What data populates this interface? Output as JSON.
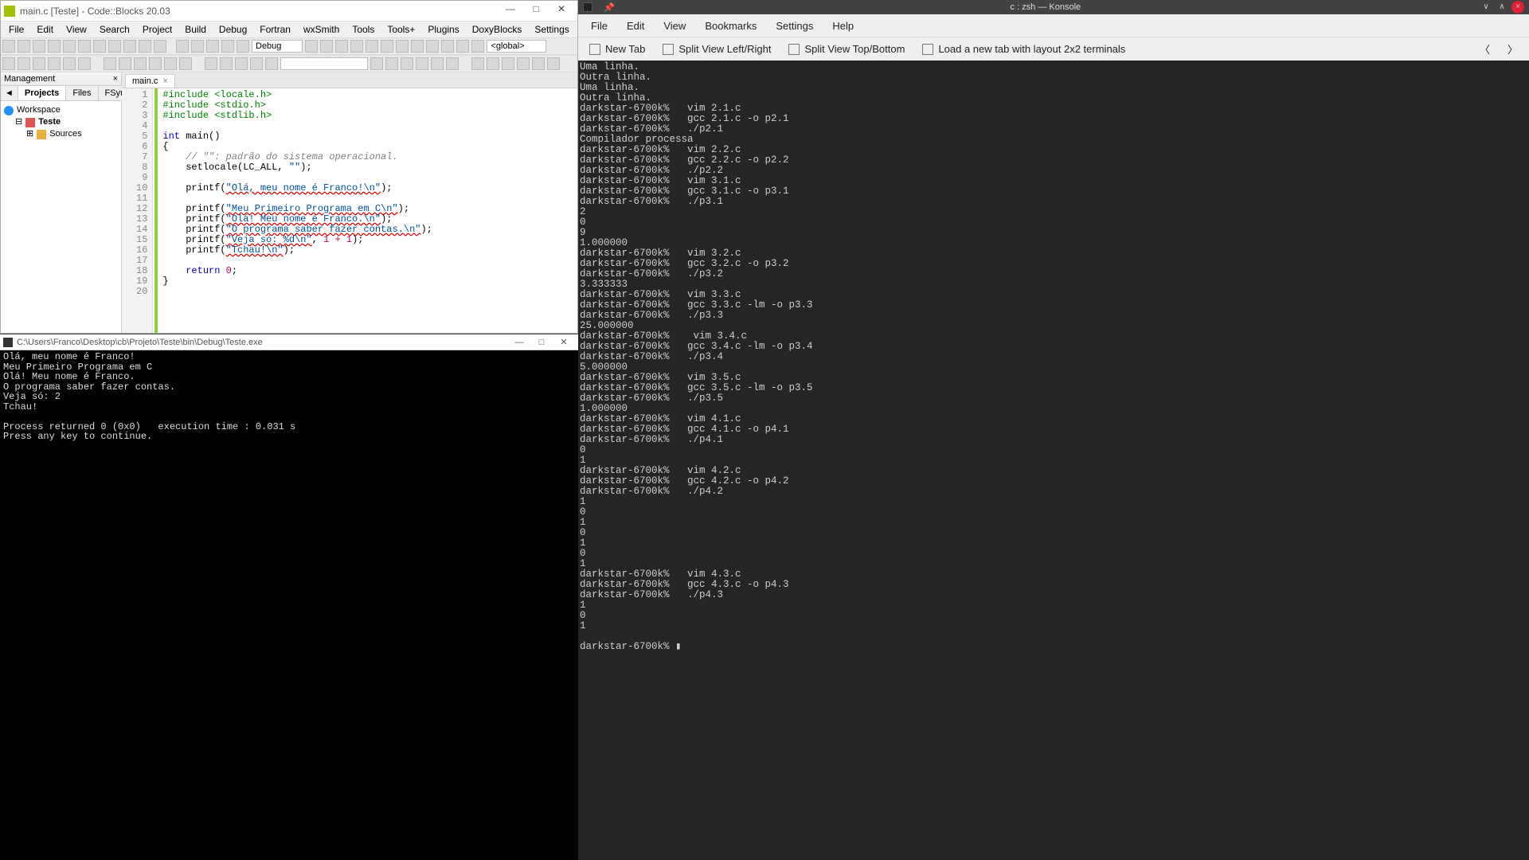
{
  "codeblocks": {
    "title": "main.c [Teste] - Code::Blocks 20.03",
    "menu": [
      "File",
      "Edit",
      "View",
      "Search",
      "Project",
      "Build",
      "Debug",
      "Fortran",
      "wxSmith",
      "Tools",
      "Tools+",
      "Plugins",
      "DoxyBlocks",
      "Settings",
      "Help"
    ],
    "buildTarget": "Debug",
    "scope": "<global>",
    "mgmt": {
      "title": "Management",
      "tabs": [
        "Projects",
        "Files",
        "FSymbols"
      ],
      "workspace": "Workspace",
      "project": "Teste",
      "sources": "Sources"
    },
    "editorTab": "main.c",
    "code": {
      "1": {
        "pre": "#include <locale.h>"
      },
      "2": {
        "pre": "#include <stdio.h>"
      },
      "3": {
        "pre": "#include <stdlib.h>"
      },
      "4": {
        "plain": ""
      },
      "5": {
        "kw": "int",
        "plain": " main()"
      },
      "6": {
        "plain": "{"
      },
      "7": {
        "cm": "    // \"\": padrão do sistema operacional."
      },
      "8": {
        "plain": "    setlocale(LC_ALL, ",
        "str": "\"\"",
        "plain2": ");"
      },
      "9": {
        "plain": ""
      },
      "10": {
        "plain": "    printf(",
        "str": "\"Olá, meu nome é Franco!\\n\"",
        "plain2": ");"
      },
      "11": {
        "plain": ""
      },
      "12": {
        "plain": "    printf(",
        "str": "\"Meu Primeiro Programa em C\\n\"",
        "plain2": ");"
      },
      "13": {
        "plain": "    printf(",
        "str": "\"Olá! Meu nome é Franco.\\n\"",
        "plain2": ");"
      },
      "14": {
        "plain": "    printf(",
        "str": "\"O programa saber fazer contas.\\n\"",
        "plain2": ");"
      },
      "15": {
        "plain": "    printf(",
        "str": "\"Veja só: %d\\n\"",
        "plain2": ", ",
        "num": "1 + 1",
        "plain3": ");"
      },
      "16": {
        "plain": "    printf(",
        "str": "\"Tchau!\\n\"",
        "plain2": ");"
      },
      "17": {
        "plain": ""
      },
      "18": {
        "plain": "    ",
        "kw": "return",
        "plain2": " ",
        "num": "0",
        "plain3": ";"
      },
      "19": {
        "plain": "}"
      },
      "20": {
        "plain": ""
      }
    }
  },
  "console": {
    "title": "C:\\Users\\Franco\\Desktop\\cb\\Projeto\\Teste\\bin\\Debug\\Teste.exe",
    "lines": [
      "Olá, meu nome é Franco!",
      "Meu Primeiro Programa em C",
      "Olá! Meu nome é Franco.",
      "O programa saber fazer contas.",
      "Veja só: 2",
      "Tchau!",
      "",
      "Process returned 0 (0x0)   execution time : 0.031 s",
      "Press any key to continue."
    ]
  },
  "konsole": {
    "title": "c : zsh — Konsole",
    "menu": [
      "File",
      "Edit",
      "View",
      "Bookmarks",
      "Settings",
      "Help"
    ],
    "toolbar": {
      "newTab": "New Tab",
      "splitLR": "Split View Left/Right",
      "splitTB": "Split View Top/Bottom",
      "layout": "Load a new tab with layout 2x2 terminals"
    },
    "prompt": "darkstar-6700k%",
    "body": "Uma linha.\nOutra linha.\nUma linha.\nOutra linha.\ndarkstar-6700k%   vim 2.1.c\ndarkstar-6700k%   gcc 2.1.c -o p2.1\ndarkstar-6700k%   ./p2.1\nCompilador processa\ndarkstar-6700k%   vim 2.2.c\ndarkstar-6700k%   gcc 2.2.c -o p2.2\ndarkstar-6700k%   ./p2.2\ndarkstar-6700k%   vim 3.1.c\ndarkstar-6700k%   gcc 3.1.c -o p3.1\ndarkstar-6700k%   ./p3.1\n2\n0\n9\n1.000000\ndarkstar-6700k%   vim 3.2.c\ndarkstar-6700k%   gcc 3.2.c -o p3.2\ndarkstar-6700k%   ./p3.2\n3.333333\ndarkstar-6700k%   vim 3.3.c\ndarkstar-6700k%   gcc 3.3.c -lm -o p3.3\ndarkstar-6700k%   ./p3.3\n25.000000\ndarkstar-6700k%    vim 3.4.c\ndarkstar-6700k%   gcc 3.4.c -lm -o p3.4\ndarkstar-6700k%   ./p3.4\n5.000000\ndarkstar-6700k%   vim 3.5.c\ndarkstar-6700k%   gcc 3.5.c -lm -o p3.5\ndarkstar-6700k%   ./p3.5\n1.000000\ndarkstar-6700k%   vim 4.1.c\ndarkstar-6700k%   gcc 4.1.c -o p4.1\ndarkstar-6700k%   ./p4.1\n0\n1\ndarkstar-6700k%   vim 4.2.c\ndarkstar-6700k%   gcc 4.2.c -o p4.2\ndarkstar-6700k%   ./p4.2\n1\n0\n1\n0\n1\n0\n1\ndarkstar-6700k%   vim 4.3.c\ndarkstar-6700k%   gcc 4.3.c -o p4.3\ndarkstar-6700k%   ./p4.3\n1\n0\n1\n\ndarkstar-6700k% ▮"
  }
}
